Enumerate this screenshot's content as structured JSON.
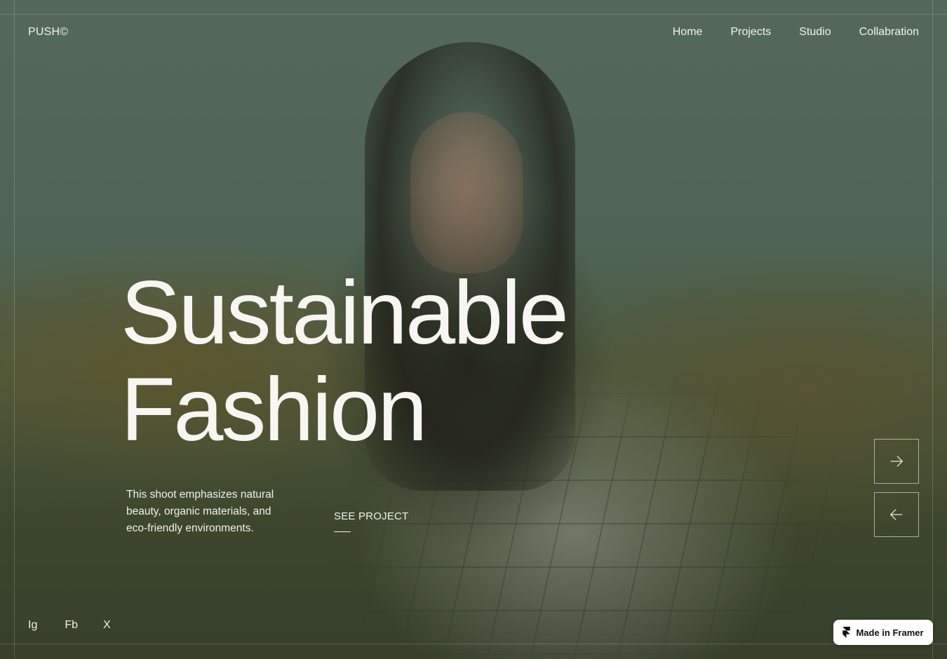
{
  "brand": {
    "logo": "PUSH©"
  },
  "nav": {
    "items": [
      {
        "label": "Home"
      },
      {
        "label": "Projects"
      },
      {
        "label": "Studio"
      },
      {
        "label": "Collabration"
      }
    ]
  },
  "hero": {
    "headline_line1": "Sustainable",
    "headline_line2": "Fashion",
    "description": "This shoot emphasizes natural beauty, organic materials, and eco-friendly environments.",
    "cta_label": "SEE PROJECT",
    "next_icon": "arrow-right-icon",
    "prev_icon": "arrow-left-icon"
  },
  "social": {
    "items": [
      {
        "label": "Ig"
      },
      {
        "label": "Fb"
      },
      {
        "label": "X"
      }
    ]
  },
  "badge": {
    "label": "Made in Framer",
    "icon": "framer-logo-icon"
  },
  "colors": {
    "text": "#f4f4ef",
    "badge_bg": "#ffffff",
    "badge_text": "#111111",
    "overlay": "#3c5a48"
  }
}
